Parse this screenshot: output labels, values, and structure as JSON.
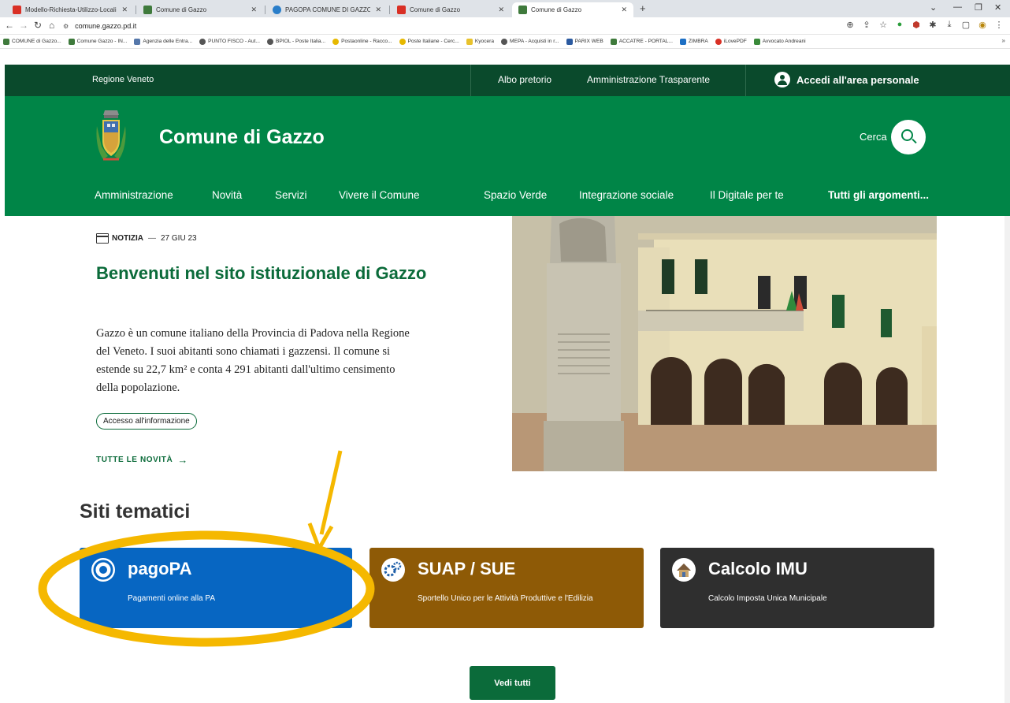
{
  "browser": {
    "tabs": [
      {
        "label": "Modello-Richiesta-Utilizzo-Locali",
        "fav": "#d93025",
        "active": false
      },
      {
        "label": "Comune di Gazzo",
        "fav": "#3f7a3c",
        "active": false
      },
      {
        "label": "PAGOPA COMUNE DI GAZZO",
        "fav": "#2a7ec9",
        "active": false
      },
      {
        "label": "Comune di Gazzo",
        "fav": "#d93025",
        "active": false
      },
      {
        "label": "Comune di Gazzo",
        "fav": "#3f7a3c",
        "active": true
      }
    ],
    "url": "comune.gazzo.pd.it",
    "bookmarks": [
      {
        "label": "COMUNE di Gazzo...",
        "fav": "#3f7a3c"
      },
      {
        "label": "Comune Gazzo - IN...",
        "fav": "#3f7a3c"
      },
      {
        "label": "Agenzia delle Entra...",
        "fav": "#5577aa"
      },
      {
        "label": "PUNTO FISCO - Aut...",
        "fav": "#555555"
      },
      {
        "label": "BPIOL - Poste Italia...",
        "fav": "#555555"
      },
      {
        "label": "Postaonline - Racco...",
        "fav": "#e6b800"
      },
      {
        "label": "Poste Italiane - Cerc...",
        "fav": "#e6b800"
      },
      {
        "label": "Kyocera",
        "fav": "#e8c22c"
      },
      {
        "label": "MEPA - Acquisti in r...",
        "fav": "#555555"
      },
      {
        "label": "PARIX WEB",
        "fav": "#2b5aa0"
      },
      {
        "label": "ACCATRE - PORTAL...",
        "fav": "#3f7a3c"
      },
      {
        "label": "ZIMBRA",
        "fav": "#1d6fc4"
      },
      {
        "label": "iLovePDF",
        "fav": "#d93025"
      },
      {
        "label": "Avvocato Andreani",
        "fav": "#3a8a3a"
      }
    ],
    "more": "»"
  },
  "header": {
    "region": "Regione Veneto",
    "albo": "Albo pretorio",
    "trasparente": "Amministrazione Trasparente",
    "login": "Accedi all'area personale",
    "brand": "Comune di Gazzo",
    "search_label": "Cerca"
  },
  "nav": [
    "Amministrazione",
    "Novità",
    "Servizi",
    "Vivere il Comune",
    "Spazio Verde",
    "Integrazione sociale",
    "Il Digitale per te",
    "Tutti gli argomenti..."
  ],
  "hero": {
    "kind": "NOTIZIA",
    "dash": "—",
    "date": "27 GIU 23",
    "title": "Benvenuti nel sito istituzionale di Gazzo",
    "text": "Gazzo è un comune italiano della Provincia di Padova nella Regione del Veneto. I suoi abitanti sono chiamati i gazzensi. Il comune si estende su 22,7 km² e conta 4 291 abitanti dall'ultimo censimento della popolazione.",
    "tag": "Accesso all'informazione",
    "all_news": "TUTTE LE NOVITÀ"
  },
  "siti": {
    "title": "Siti tematici",
    "cards": [
      {
        "title": "pagoPA",
        "desc": "Pagamenti online alla PA",
        "color": "#0766c2"
      },
      {
        "title": "SUAP / SUE",
        "desc": "Sportello Unico per le Attività Produttive e l'Edilizia",
        "color": "#8e5a06"
      },
      {
        "title": "Calcolo IMU",
        "desc": "Calcolo Imposta Unica Municipale",
        "color": "#2f2f2f"
      }
    ],
    "vedi": "Vedi tutti"
  },
  "colors": {
    "green": "#008547",
    "dark_green": "#0a4a2c",
    "highlight": "#f5b800"
  }
}
